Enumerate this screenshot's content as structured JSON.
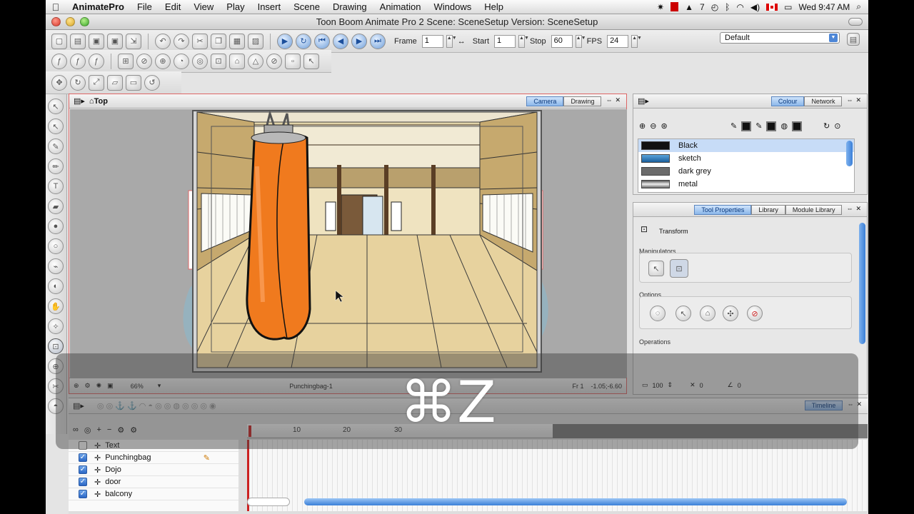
{
  "menubar": {
    "app_name": "AnimatePro",
    "items": [
      "File",
      "Edit",
      "View",
      "Play",
      "Insert",
      "Scene",
      "Drawing",
      "Animation",
      "Windows",
      "Help"
    ],
    "status_number": "7",
    "clock": "Wed 9:47 AM"
  },
  "window": {
    "title": "Toon Boom Animate Pro 2 Scene: SceneSetup Version: SceneSetup"
  },
  "playback": {
    "frame_label": "Frame",
    "frame_value": "1",
    "start_label": "Start",
    "start_value": "1",
    "stop_label": "Stop",
    "stop_value": "60",
    "fps_label": "FPS",
    "fps_value": "24"
  },
  "workspace": {
    "selected": "Default"
  },
  "camera_view": {
    "breadcrumb": "Top",
    "tabs": [
      "Camera",
      "Drawing"
    ],
    "active_tab": "Camera",
    "zoom": "66%",
    "selected_element": "Punchingbag-1",
    "frame_readout": "Fr 1",
    "coords": "-1.05;-6.60"
  },
  "colour_panel": {
    "tabs": [
      "Colour",
      "Network"
    ],
    "swatches": [
      {
        "name": "Black",
        "color": "#111111"
      },
      {
        "name": "sketch",
        "color": "#2f86c7"
      },
      {
        "name": "dark grey",
        "color": "#6b6b6b"
      },
      {
        "name": "metal",
        "color": "#a8a8a8"
      }
    ]
  },
  "tool_properties": {
    "tabs": [
      "Tool Properties",
      "Library",
      "Module Library"
    ],
    "tool_name": "Transform",
    "manipulators_label": "Manipulators",
    "options_label": "Options",
    "operations_label": "Operations",
    "width_value": "100",
    "val_a": "0",
    "val_b": "0"
  },
  "timeline": {
    "tab": "Timeline",
    "ruler_marks": [
      "10",
      "20",
      "30"
    ],
    "layers": [
      {
        "name": "Text",
        "checked": false
      },
      {
        "name": "Punchingbag",
        "checked": true
      },
      {
        "name": "Dojo",
        "checked": true
      },
      {
        "name": "door",
        "checked": true
      },
      {
        "name": "balcony",
        "checked": true
      }
    ]
  },
  "overlay": {
    "shortcut": "⌘Z"
  },
  "colors": {
    "accent_blue": "#3a7fd8",
    "punching_bag": "#f07a1e",
    "selection_red": "#d66666"
  }
}
